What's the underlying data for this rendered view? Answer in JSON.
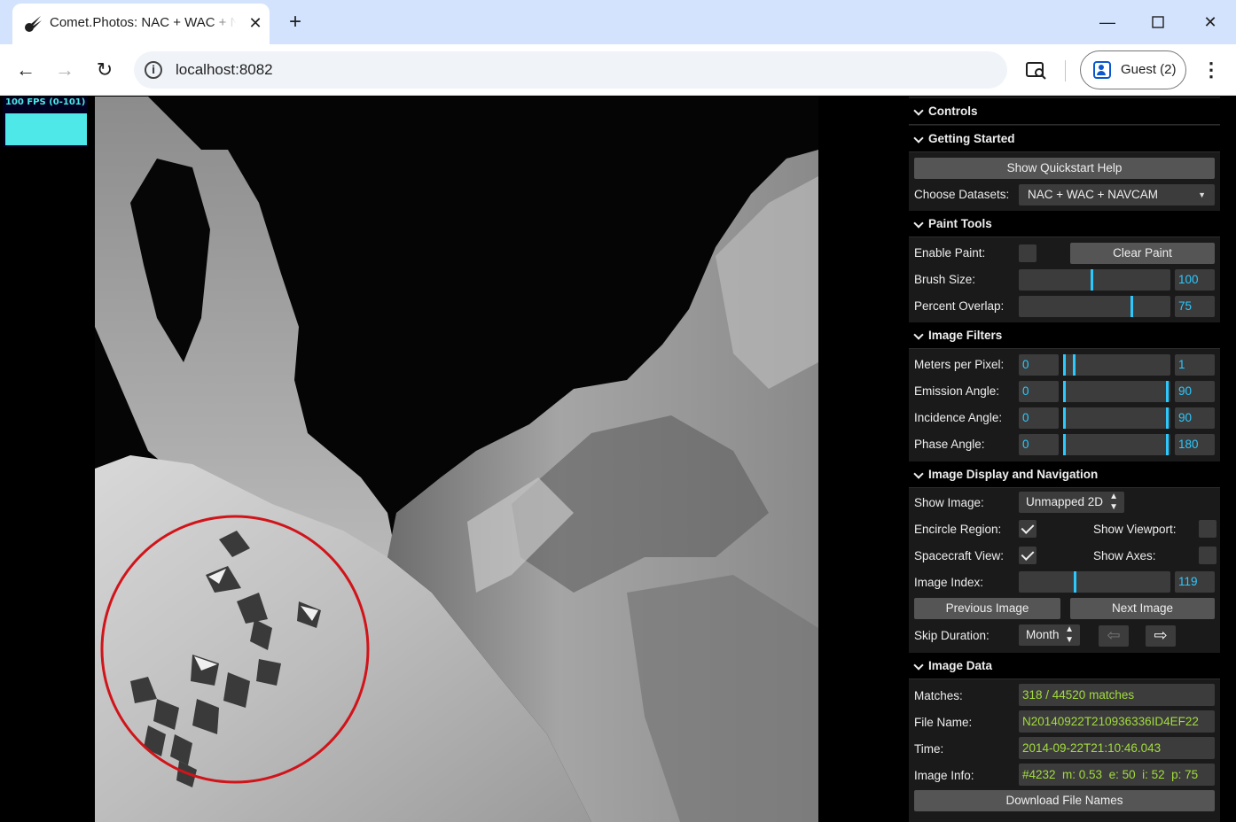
{
  "browser": {
    "tab_title": "Comet.Photos: NAC + WAC + NAVCAM",
    "url": "localhost:8082",
    "profile_label": "Guest (2)"
  },
  "stats": {
    "fps_text": "100 FPS (0-101)"
  },
  "gui": {
    "controls_title": "Controls",
    "getting_started": {
      "title": "Getting Started",
      "quickstart_button": "Show Quickstart Help",
      "datasets_label": "Choose Datasets:",
      "datasets_value": "NAC + WAC + NAVCAM"
    },
    "paint_tools": {
      "title": "Paint Tools",
      "enable_paint_label": "Enable Paint:",
      "enable_paint": false,
      "clear_paint_button": "Clear Paint",
      "brush_size_label": "Brush Size:",
      "brush_size_value": "100",
      "brush_size_fraction": 0.48,
      "percent_overlap_label": "Percent Overlap:",
      "percent_overlap_value": "75",
      "percent_overlap_fraction": 0.75
    },
    "image_filters": {
      "title": "Image Filters",
      "meters_label": "Meters per Pixel:",
      "meters_min": "0",
      "meters_max": "1",
      "emission_label": "Emission Angle:",
      "emission_min": "0",
      "emission_max": "90",
      "incidence_label": "Incidence Angle:",
      "incidence_min": "0",
      "incidence_max": "90",
      "phase_label": "Phase Angle:",
      "phase_min": "0",
      "phase_max": "180"
    },
    "display_nav": {
      "title": "Image Display and Navigation",
      "show_image_label": "Show Image:",
      "show_image_value": "Unmapped 2D",
      "encircle_label": "Encircle Region:",
      "encircle": true,
      "show_viewport_label": "Show Viewport:",
      "show_viewport": false,
      "spacecraft_label": "Spacecraft View:",
      "spacecraft": true,
      "show_axes_label": "Show Axes:",
      "show_axes": false,
      "image_index_label": "Image Index:",
      "image_index_value": "119",
      "image_index_fraction": 0.37,
      "previous_button": "Previous Image",
      "next_button": "Next Image",
      "skip_label": "Skip Duration:",
      "skip_value": "Month",
      "back_arrow_icon": "left-arrow-icon",
      "forward_arrow_icon": "right-arrow-icon"
    },
    "image_data": {
      "title": "Image Data",
      "matches_label": "Matches:",
      "matches_value": "318 / 44520 matches",
      "file_name_label": "File Name:",
      "file_name_value": "N20140922T210936336ID4EF22",
      "time_label": "Time:",
      "time_value": "2014-09-22T21:10:46.043",
      "image_info_label": "Image Info:",
      "image_info_value": "#4232  m: 0.53  e: 50  i: 52  p: 75",
      "download_button": "Download File Names"
    }
  },
  "colors": {
    "accent": "#2cc9ff",
    "text_value": "#a2db3c",
    "encircle": "#d0141a",
    "stats": "#4ee8e8"
  }
}
